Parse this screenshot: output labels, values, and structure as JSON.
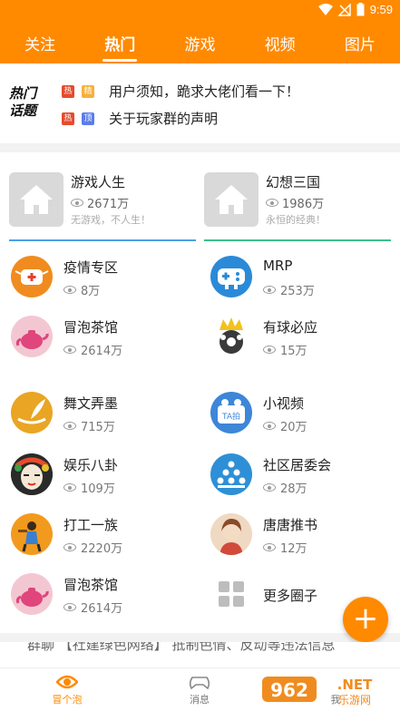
{
  "status": {
    "time": "9:59"
  },
  "top_nav": {
    "tabs": [
      {
        "label": "关注"
      },
      {
        "label": "热门"
      },
      {
        "label": "游戏"
      },
      {
        "label": "视频"
      },
      {
        "label": "图片"
      }
    ],
    "active_tab": "热门"
  },
  "hot_topics": {
    "logo_line1": "热门",
    "logo_line2": "话题",
    "items": [
      {
        "tag1": "热",
        "tag2": "精",
        "text": "用户须知，跪求大佬们看一下！"
      },
      {
        "tag1": "热",
        "tag2": "顶",
        "text": "关于玩家群的声明"
      }
    ]
  },
  "featured": [
    {
      "title": "游戏人生",
      "views": "2671万",
      "desc": "无游戏，不人生！"
    },
    {
      "title": "幻想三国",
      "views": "1986万",
      "desc": "永恒的经典！"
    }
  ],
  "circles": [
    {
      "name": "疫情专区",
      "views": "8万"
    },
    {
      "name": "MRP",
      "views": "253万"
    },
    {
      "name": "冒泡茶馆",
      "views": "2614万"
    },
    {
      "name": "有球必应",
      "views": "15万"
    },
    {
      "name": "舞文弄墨",
      "views": "715万"
    },
    {
      "name": "小视频",
      "views": "20万"
    },
    {
      "name": "娱乐八卦",
      "views": "109万"
    },
    {
      "name": "社区居委会",
      "views": "28万"
    },
    {
      "name": "打工一族",
      "views": "2220万"
    },
    {
      "name": "唐唐推书",
      "views": "12万"
    },
    {
      "name": "冒泡茶馆",
      "views": "2614万"
    },
    {
      "name": "更多圈子",
      "views": ""
    }
  ],
  "ticker": {
    "text": "群聊 【社建绿色网络】 抵制色情、反动等违法信息"
  },
  "bottom_nav": {
    "items": [
      {
        "label": "冒个泡"
      },
      {
        "label": "消息"
      },
      {
        "label": "我"
      }
    ]
  },
  "fab": {
    "label": "+"
  },
  "watermark": {
    "brand": "962.NET",
    "sub": "乐游网"
  }
}
